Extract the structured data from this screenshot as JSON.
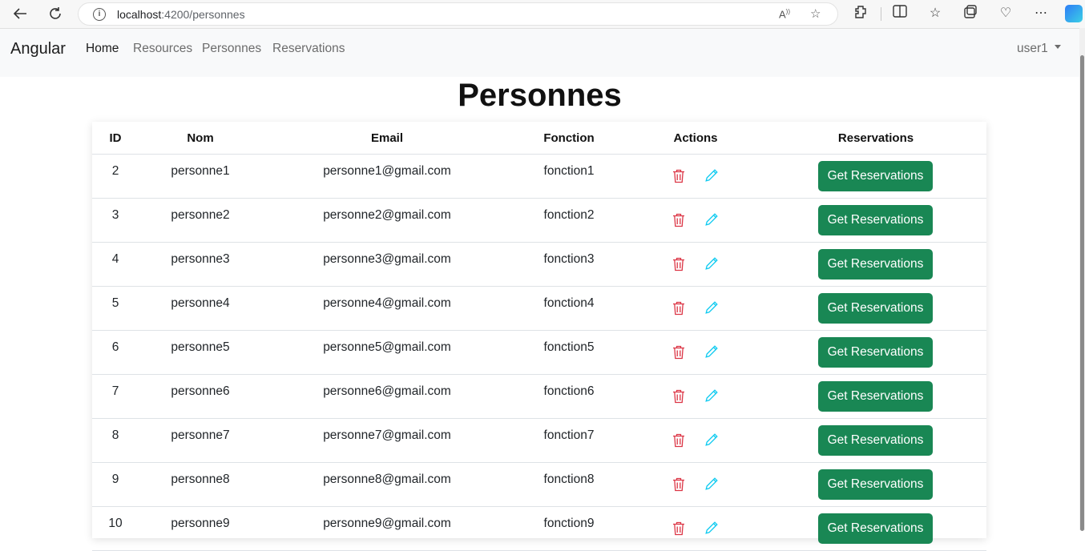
{
  "browser": {
    "url_host": "localhost",
    "url_path": ":4200/personnes"
  },
  "navbar": {
    "brand": "Angular",
    "links": [
      "Home",
      "Resources",
      "Personnes",
      "Reservations"
    ],
    "user": "user1"
  },
  "page": {
    "title": "Personnes"
  },
  "table": {
    "headers": [
      "ID",
      "Nom",
      "Email",
      "Fonction",
      "Actions",
      "Reservations"
    ],
    "button_label": "Get Reservations",
    "rows": [
      {
        "id": "2",
        "nom": "personne1",
        "email": "personne1@gmail.com",
        "fonction": "fonction1"
      },
      {
        "id": "3",
        "nom": "personne2",
        "email": "personne2@gmail.com",
        "fonction": "fonction2"
      },
      {
        "id": "4",
        "nom": "personne3",
        "email": "personne3@gmail.com",
        "fonction": "fonction3"
      },
      {
        "id": "5",
        "nom": "personne4",
        "email": "personne4@gmail.com",
        "fonction": "fonction4"
      },
      {
        "id": "6",
        "nom": "personne5",
        "email": "personne5@gmail.com",
        "fonction": "fonction5"
      },
      {
        "id": "7",
        "nom": "personne6",
        "email": "personne6@gmail.com",
        "fonction": "fonction6"
      },
      {
        "id": "8",
        "nom": "personne7",
        "email": "personne7@gmail.com",
        "fonction": "fonction7"
      },
      {
        "id": "9",
        "nom": "personne8",
        "email": "personne8@gmail.com",
        "fonction": "fonction8"
      },
      {
        "id": "10",
        "nom": "personne9",
        "email": "personne9@gmail.com",
        "fonction": "fonction9"
      }
    ]
  },
  "colors": {
    "button": "#198754",
    "delete_icon": "#dc3545",
    "edit_icon": "#0dcaf0"
  },
  "icons": [
    "back-icon",
    "refresh-icon",
    "info-icon",
    "read-aloud-icon",
    "favorite-star-icon",
    "extensions-icon",
    "split-screen-icon",
    "favorites-icon",
    "collections-icon",
    "health-icon",
    "more-icon",
    "copilot-icon",
    "trash-icon",
    "pencil-icon"
  ]
}
